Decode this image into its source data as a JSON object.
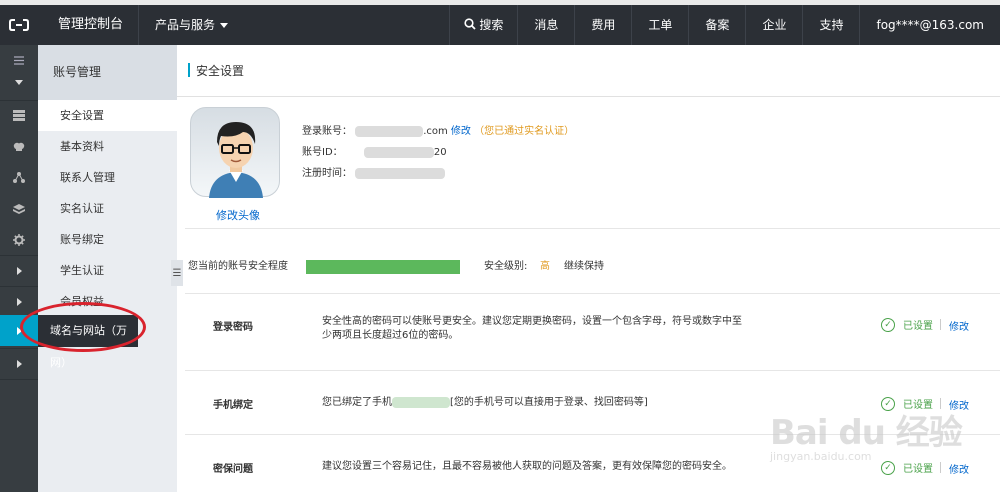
{
  "topbar": {
    "title": "管理控制台",
    "products": "产品与服务",
    "nav": [
      "搜索",
      "消息",
      "费用",
      "工单",
      "备案",
      "企业",
      "支持",
      "fog****@163.com"
    ]
  },
  "subnav": {
    "head": "账号管理",
    "items": [
      "安全设置",
      "基本资料",
      "联系人管理",
      "实名认证",
      "账号绑定",
      "学生认证",
      "会员权益"
    ]
  },
  "tooltip": "域名与网站（万网）",
  "page": {
    "title": "安全设置",
    "avatar_link": "修改头像",
    "account_label": "登录账号：",
    "account_suffix": ".com",
    "account_modify": "修改",
    "account_note": "（您已通过实名认证）",
    "id_label": "账号ID：",
    "id_suffix": "20",
    "reg_label": "注册时间："
  },
  "level": {
    "label": "您当前的账号安全程度",
    "progress": 1.0,
    "level_label": "安全级别:",
    "level_value": "高",
    "keep": "继续保持"
  },
  "sections": [
    {
      "name": "登录密码",
      "desc": "安全性高的密码可以使账号更安全。建议您定期更换密码，设置一个包含字母，符号或数字中至少两项且长度超过6位的密码。",
      "status": "已设置",
      "modify": "修改"
    },
    {
      "name": "手机绑定",
      "desc_prefix": "您已绑定了手机",
      "desc_suffix": "[您的手机号可以直接用于登录、找回密码等]",
      "status": "已设置",
      "modify": "修改"
    },
    {
      "name": "密保问题",
      "desc": "建议您设置三个容易记住，且最不容易被他人获取的问题及答案，更有效保障您的密码安全。",
      "status": "已设置",
      "modify": "修改"
    }
  ],
  "watermark": {
    "big": "Bai du 经验",
    "small": "jingyan.baidu.com"
  },
  "colors": {
    "topbar": "#2b2f35",
    "rail": "#373d41",
    "accent": "#00a2ca",
    "ok": "#4aa24a",
    "progress": "#5cb85c",
    "note": "#e09a1f",
    "highlight": "#d9232d"
  }
}
